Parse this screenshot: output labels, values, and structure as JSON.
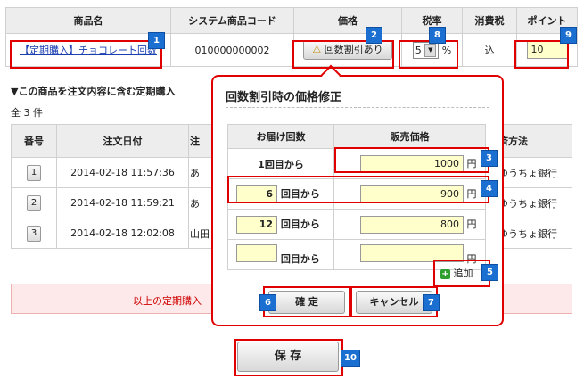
{
  "product_table": {
    "headers": [
      "商品名",
      "システム商品コード",
      "価格",
      "税率",
      "消費税",
      "ポイント"
    ],
    "product_link": "【定期購入】チョコレート回数",
    "code": "010000000002",
    "price_button": "回数割引あり",
    "tax_rate": "5",
    "tax_unit": "%",
    "consumption_tax": "込",
    "points": "10"
  },
  "section": {
    "title": "▼この商品を注文内容に含む定期購入",
    "count": "全 3 件"
  },
  "orders": {
    "headers": [
      "番号",
      "注文日付",
      "注",
      "済方法"
    ],
    "rows": [
      {
        "num": "1",
        "date": "2014-02-18 11:57:36",
        "customer": "あ",
        "payment": "ゆうちょ銀行"
      },
      {
        "num": "2",
        "date": "2014-02-18 11:59:21",
        "customer": "あ",
        "payment": "ゆうちょ銀行"
      },
      {
        "num": "3",
        "date": "2014-02-18 12:02:08",
        "customer": "山田",
        "payment": "ゆうちょ銀行"
      }
    ]
  },
  "notice": "以上の定期購入",
  "popup": {
    "title": "回数割引時の価格修正",
    "col_count": "お届け回数",
    "col_price": "販売価格",
    "rows": [
      {
        "count": "",
        "label": "1回目から",
        "price": "1000",
        "unit": "円"
      },
      {
        "count": "6",
        "label": "回目から",
        "price": "900",
        "unit": "円"
      },
      {
        "count": "12",
        "label": "回目から",
        "price": "800",
        "unit": "円"
      },
      {
        "count": "",
        "label": "回目から",
        "price": "",
        "unit": "円"
      }
    ],
    "add_label": "追加",
    "confirm": "確 定",
    "cancel": "キャンセル"
  },
  "save_button": "保 存",
  "badges": [
    "1",
    "2",
    "3",
    "4",
    "5",
    "6",
    "7",
    "8",
    "9",
    "10"
  ],
  "colors": {
    "highlight": "#e00000",
    "badge": "#1a6fd1",
    "input_bg": "#ffffcc"
  }
}
